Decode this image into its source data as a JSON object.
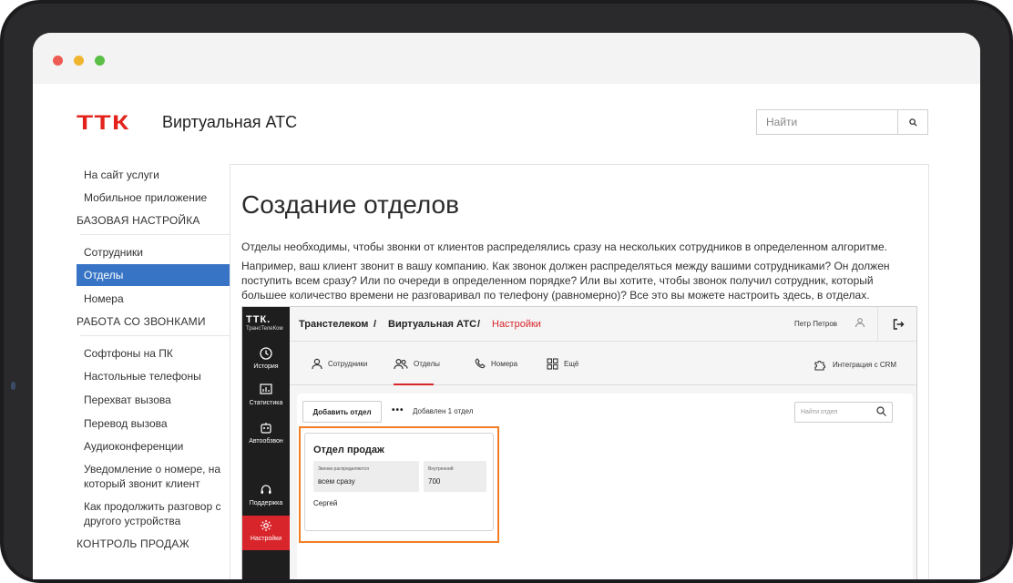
{
  "site": {
    "logo": "ТТК",
    "title": "Виртуальная АТС",
    "search_placeholder": "Найти"
  },
  "sidebar": {
    "links": [
      "На сайт услуги",
      "Мобильное приложение"
    ],
    "section_basic": "БАЗОВАЯ НАСТРОЙКА",
    "basic_items": [
      "Сотрудники",
      "Отделы",
      "Номера"
    ],
    "section_calls": "РАБОТА СО ЗВОНКАМИ",
    "call_items": [
      "Софтфоны на ПК",
      "Настольные телефоны",
      "Перехват вызова",
      "Перевод вызова",
      "Аудиоконференции",
      "Уведомление о номере, на который звонит клиент",
      "Как продолжить разговор с другого устройства"
    ],
    "section_sales": "КОНТРОЛЬ ПРОДАЖ"
  },
  "article": {
    "title": "Создание отделов",
    "para1": "Отделы необходимы, чтобы звонки от клиентов распределялись сразу на нескольких сотрудников в определенном алгоритме.",
    "para2": "Например, ваш клиент звонит в вашу компанию. Как звонок должен распределяться между вашими сотрудниками? Он должен поступить всем сразу? Или по очереди в определенном порядке? Или вы хотите, чтобы звонок получил сотрудник, который большее количество времени не разговаривал по телефону (равномерно)? Все это вы можете настроить здесь, в отделах."
  },
  "app": {
    "logo": "ТТК.",
    "logo_sub": "ТрансТелеКом",
    "side_items": [
      "История",
      "Статистика",
      "Автообзвон",
      "Поддержка",
      "Настройки"
    ],
    "breadcrumb": [
      "Транстелеком",
      "Виртуальная АТС",
      "Настройки"
    ],
    "breadcrumb_sep": "/",
    "user_name": "Петр Петров",
    "tabs": [
      "Сотрудники",
      "Отделы",
      "Номера",
      "Ещё"
    ],
    "crm": "Интеграция с CRM",
    "add_button": "Добавить отдел",
    "more": "•••",
    "added_text": "Добавлен 1 отдел",
    "search_placeholder": "Найти отдел",
    "card": {
      "title": "Отдел продаж",
      "dist_label": "Звонки распределяются",
      "dist_value": "всем сразу",
      "internal_label": "Внутренний",
      "internal_value": "700",
      "person": "Сергей"
    }
  },
  "colors": {
    "brand_red": "#e3231b",
    "nav_active": "#3774c5",
    "highlight": "#f07e26",
    "app_sidebar": "#1e1e1e"
  }
}
